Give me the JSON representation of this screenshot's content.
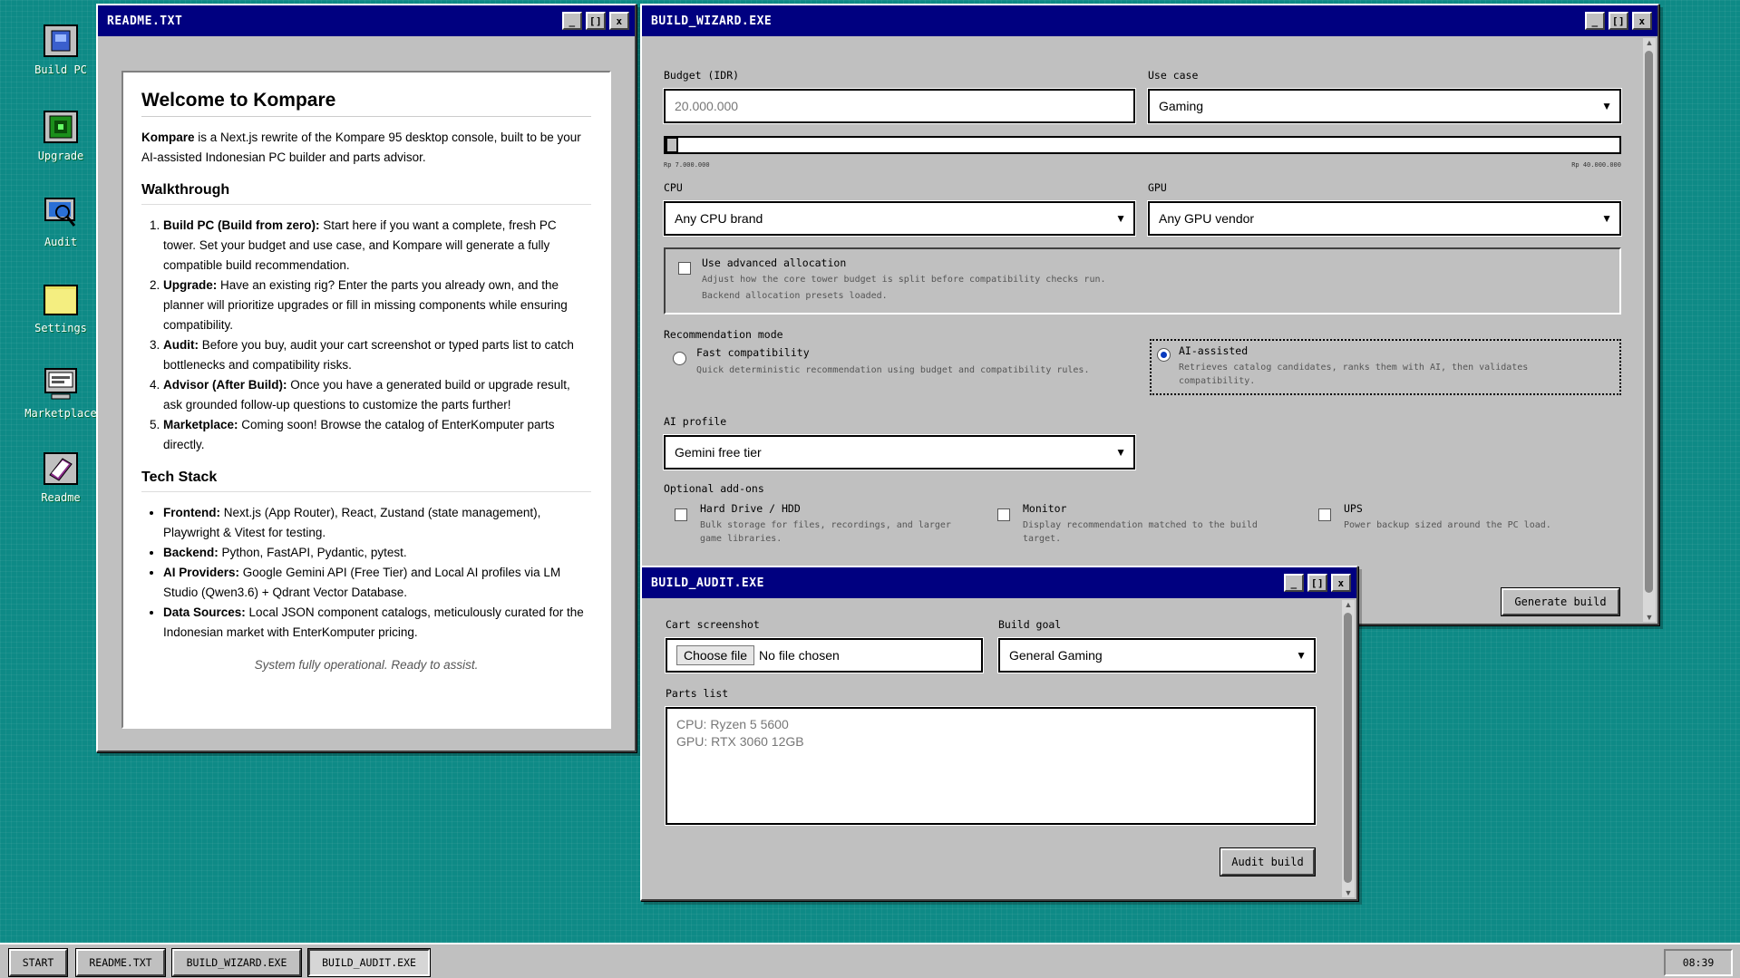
{
  "desktop": {
    "icons": [
      {
        "label": "Build PC"
      },
      {
        "label": "Upgrade"
      },
      {
        "label": "Audit"
      },
      {
        "label": "Settings"
      },
      {
        "label": "Marketplace"
      },
      {
        "label": "Readme"
      }
    ]
  },
  "readme": {
    "title": "README.TXT",
    "heading": "Welcome to Kompare",
    "intro_bold": "Kompare",
    "intro_rest": " is a Next.js rewrite of the Kompare 95 desktop console, built to be your AI-assisted Indonesian PC builder and parts advisor.",
    "walkthrough_heading": "Walkthrough",
    "walkthrough": [
      {
        "bold": "Build PC (Build from zero):",
        "text": " Start here if you want a complete, fresh PC tower. Set your budget and use case, and Kompare will generate a fully compatible build recommendation."
      },
      {
        "bold": "Upgrade:",
        "text": " Have an existing rig? Enter the parts you already own, and the planner will prioritize upgrades or fill in missing components while ensuring compatibility."
      },
      {
        "bold": "Audit:",
        "text": " Before you buy, audit your cart screenshot or typed parts list to catch bottlenecks and compatibility risks."
      },
      {
        "bold": "Advisor (After Build):",
        "text": " Once you have a generated build or upgrade result, ask grounded follow-up questions to customize the parts further!"
      },
      {
        "bold": "Marketplace:",
        "text": " Coming soon! Browse the catalog of EnterKomputer parts directly."
      }
    ],
    "techstack_heading": "Tech Stack",
    "techstack": [
      {
        "bold": "Frontend:",
        "text": " Next.js (App Router), React, Zustand (state management), Playwright & Vitest for testing."
      },
      {
        "bold": "Backend:",
        "text": " Python, FastAPI, Pydantic, pytest."
      },
      {
        "bold": "AI Providers:",
        "text": " Google Gemini API (Free Tier) and Local AI profiles via LM Studio (Qwen3.6) + Qdrant Vector Database."
      },
      {
        "bold": "Data Sources:",
        "text": " Local JSON component catalogs, meticulously curated for the Indonesian market with EnterKomputer pricing."
      }
    ],
    "footer": "System fully operational. Ready to assist."
  },
  "wizard": {
    "title": "BUILD_WIZARD.EXE",
    "budget_label": "Budget (IDR)",
    "budget_placeholder": "20.000.000",
    "usecase_label": "Use case",
    "usecase_value": "Gaming",
    "slider_min": "Rp 7.000.000",
    "slider_max": "Rp 40.000.000",
    "slider_fraction": 0.0,
    "cpu_label": "CPU",
    "cpu_value": "Any CPU brand",
    "gpu_label": "GPU",
    "gpu_value": "Any GPU vendor",
    "advanced_title": "Use advanced allocation",
    "advanced_desc1": "Adjust how the core tower budget is split before compatibility checks run.",
    "advanced_desc2": "Backend allocation presets loaded.",
    "mode_label": "Recommendation mode",
    "mode_fast_title": "Fast compatibility",
    "mode_fast_desc": "Quick deterministic recommendation using budget and compatibility rules.",
    "mode_ai_title": "AI-assisted",
    "mode_ai_desc": "Retrieves catalog candidates, ranks them with AI, then validates compatibility.",
    "ai_profile_label": "AI profile",
    "ai_profile_value": "Gemini free tier",
    "addons_label": "Optional add-ons",
    "addons": [
      {
        "title": "Hard Drive / HDD",
        "desc": "Bulk storage for files, recordings, and larger game libraries."
      },
      {
        "title": "Monitor",
        "desc": "Display recommendation matched to the build target."
      },
      {
        "title": "UPS",
        "desc": "Power backup sized around the PC load."
      }
    ],
    "generate_label": "Generate build"
  },
  "audit": {
    "title": "BUILD_AUDIT.EXE",
    "cart_label": "Cart screenshot",
    "choose_file": "Choose file",
    "no_file": "No file chosen",
    "goal_label": "Build goal",
    "goal_value": "General Gaming",
    "parts_label": "Parts list",
    "parts_placeholder": "CPU: Ryzen 5 5600\nGPU: RTX 3060 12GB",
    "audit_label": "Audit build"
  },
  "taskbar": {
    "start": "START",
    "items": [
      "README.TXT",
      "BUILD_WIZARD.EXE",
      "BUILD_AUDIT.EXE"
    ],
    "clock": "08:39"
  },
  "colors": {
    "desktop": "#0e8a86",
    "titlebar": "#000080",
    "window": "#c0c0c0"
  }
}
